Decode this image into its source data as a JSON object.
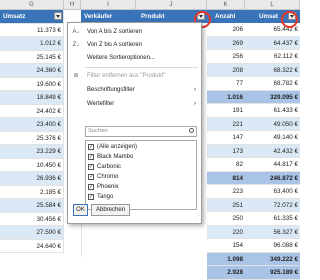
{
  "column_headers": [
    "G",
    "H",
    "I",
    "J",
    "K",
    "L"
  ],
  "left_table": {
    "header": "Umsatz",
    "values": [
      "11.373 €",
      "1.012 €",
      "25.145 €",
      "24.360 €",
      "19.600 €",
      "18.849 €",
      "24.402 €",
      "23.400 €",
      "25.376 €",
      "23.229 €",
      "10.450 €",
      "26.936 €",
      "2.185 €",
      "25.584 €",
      "30.456 €",
      "27.500 €",
      "24.640 €"
    ]
  },
  "right_table": {
    "headers": {
      "seller": "Verkäufer",
      "product": "Produkt",
      "count": "Anzahl",
      "revenue": "Umsat"
    },
    "rows": [
      {
        "count": "206",
        "revenue": "65.442 €",
        "style": "normal"
      },
      {
        "count": "269",
        "revenue": "64.437 €",
        "style": "alt"
      },
      {
        "count": "256",
        "revenue": "62.112 €",
        "style": "normal"
      },
      {
        "count": "208",
        "revenue": "68.322 €",
        "style": "alt"
      },
      {
        "count": "77",
        "revenue": "68.782 €",
        "style": "normal"
      },
      {
        "count": "1.016",
        "revenue": "329.095 €",
        "style": "bold"
      },
      {
        "count": "191",
        "revenue": "61.433 €",
        "style": "normal"
      },
      {
        "count": "221",
        "revenue": "49.050 €",
        "style": "alt"
      },
      {
        "count": "147",
        "revenue": "49.140 €",
        "style": "normal"
      },
      {
        "count": "173",
        "revenue": "42.432 €",
        "style": "alt"
      },
      {
        "count": "82",
        "revenue": "44.817 €",
        "style": "normal"
      },
      {
        "count": "814",
        "revenue": "246.872 €",
        "style": "bold"
      },
      {
        "count": "223",
        "revenue": "63.400 €",
        "style": "normal"
      },
      {
        "count": "251",
        "revenue": "72.072 €",
        "style": "alt"
      },
      {
        "count": "250",
        "revenue": "61.335 €",
        "style": "normal"
      },
      {
        "count": "220",
        "revenue": "56.327 €",
        "style": "alt"
      },
      {
        "count": "154",
        "revenue": "96.088 €",
        "style": "normal"
      },
      {
        "count": "1.098",
        "revenue": "349.222 €",
        "style": "bold"
      },
      {
        "count": "2.928",
        "revenue": "925.189 €",
        "style": "bold"
      }
    ]
  },
  "filter_menu": {
    "sort_asc": "Von A bis Z sortieren",
    "sort_desc": "Von Z bis A sortieren",
    "more_sort": "Weitere Sortieroptionen...",
    "clear_filter": "Filter entfernen aus \"Produkt\"",
    "label_filter": "Beschriftungsfilter",
    "value_filter": "Wertefilter",
    "search_placeholder": "Suchen",
    "items": [
      "(Alle anzeigen)",
      "Black Mambo",
      "Carbonic",
      "Chromo",
      "Phoenix",
      "Tango"
    ],
    "ok": "OK",
    "cancel": "Abbrechen"
  },
  "colors": {
    "header_blue": "#3a74b8",
    "band_blue": "#dbe8f6",
    "highlight_red": "#e8352a"
  }
}
